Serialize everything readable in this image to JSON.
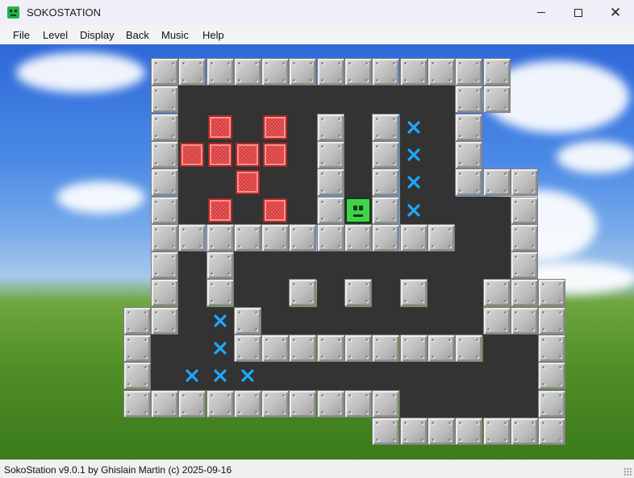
{
  "window": {
    "title": "SOKOSTATION",
    "controls": {
      "minimize": "minimize",
      "maximize": "maximize",
      "close": "close"
    }
  },
  "menu": [
    "File",
    "Level",
    "Display",
    "Back",
    "Music",
    "Help"
  ],
  "status": {
    "text": "SokoStation v9.0.1 by Ghislain Martin (c) 2025-09-16"
  },
  "level": {
    "rows": [
      "   #############  ",
      "   #          ##  ",
      "   # $ $ # #. #   ",
      "   #$$$$ # #. #   ",
      "   #  $  # #. ### ",
      "   # $ $ #@#.   # ",
      "   ###########  # ",
      "   # #          # ",
      "   # #  # # #  ###",
      "  ## .#        ###",
      "  #  .#########  #",
      "  # ...          #",
      "  ##########     #",
      "           #######"
    ],
    "legend": {
      "wall": "#",
      "crate": "$",
      "goal": ".",
      "player": "@",
      "floor": " "
    }
  },
  "background": "green-hills-blue-sky-wallpaper",
  "colors": {
    "crate": "#f25c5c",
    "goal": "#1fa7ff",
    "player": "#3fd34a",
    "floor": "#333333",
    "wall": "#c4c4c4"
  }
}
